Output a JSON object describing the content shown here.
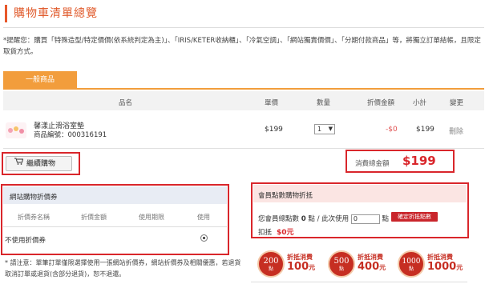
{
  "header": {
    "title": "購物車清單總覽"
  },
  "notice": "*提醒您：購買「特殊造型/特定價價(依系統判定為主)」、「IRIS/KETER收納櫃」、「冷氣空調」、「網站獨賣價價」、「分期付款商品」等，將獨立訂單結帳，且限定取貨方式。",
  "tab": {
    "label": "一般商品"
  },
  "table": {
    "headers": {
      "product": "品名",
      "price": "單價",
      "qty": "數量",
      "discount": "折價金額",
      "subtotal": "小計",
      "change": "變更"
    },
    "row": {
      "name": "馨漾止滑浴室墊",
      "code": "商品編號：000316191",
      "price": "$199",
      "qty": "1",
      "discount": "-$0",
      "subtotal": "$199",
      "action": "刪除"
    }
  },
  "continue_button": "繼續購物",
  "total": {
    "label": "消費總金額",
    "value": "$199"
  },
  "coupon": {
    "title": "網站購物折價券",
    "headers": {
      "name": "折價券名稱",
      "amount": "折價金額",
      "period": "使用期限",
      "use": "使用"
    },
    "no_coupon": "不使用折價券"
  },
  "footnote": "* 請注意：單筆訂單僅限選擇使用一張網站折價券，網站折價券及相關優惠，若退貨取消訂單或退貨(含部分退貨)，恕不退還。",
  "points": {
    "title": "會員點數購物折抵",
    "total_label": "您會員總點數",
    "total_value": "0",
    "unit": "點",
    "use_label": "/ 此次使用",
    "use_value": "0",
    "apply_button": "確定折抵點數",
    "discount_label": "扣抵",
    "discount_value": "$0元"
  },
  "badges": [
    {
      "points": "200",
      "point_label": "點",
      "label": "折抵消費",
      "amount": "100",
      "unit": "元"
    },
    {
      "points": "500",
      "point_label": "點",
      "label": "折抵消費",
      "amount": "400",
      "unit": "元"
    },
    {
      "points": "1000",
      "point_label": "點",
      "label": "折抵消費",
      "amount": "1000",
      "unit": "元"
    }
  ],
  "colors": {
    "accent": "#e05a2b",
    "tab": "#f29d3c",
    "highlight": "#d9262b",
    "badge": "#c62e22"
  },
  "icons": {
    "cart": "cart-icon",
    "select_arrow": "chevron-down-icon"
  }
}
